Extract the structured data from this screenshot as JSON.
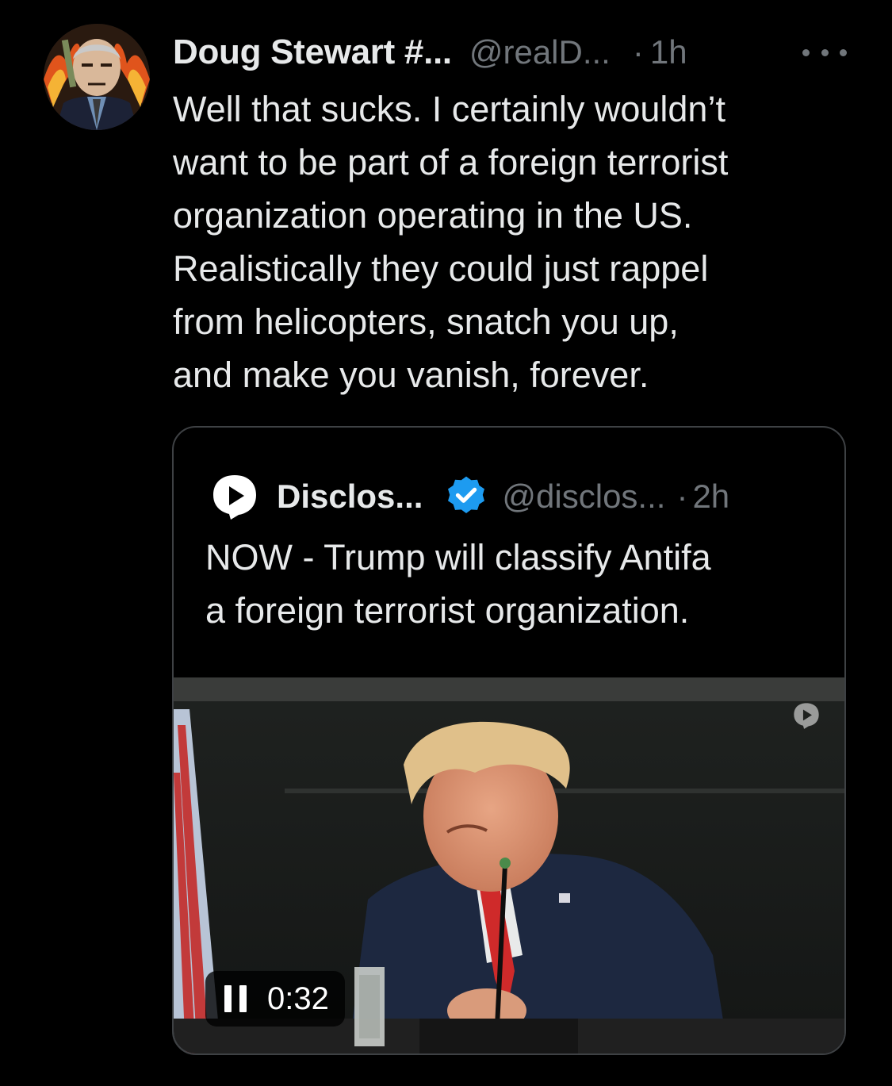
{
  "post": {
    "author": {
      "display_name": "Doug Stewart #...",
      "handle": "@realD...",
      "separator": "·",
      "time": "1h"
    },
    "text_lines": [
      "Well that sucks. I certainly wouldn’t",
      "want to be part of a foreign terrorist",
      "organization operating in the US.",
      "Realistically they could just rappel",
      "from helicopters, snatch you up,",
      "and make you vanish, forever."
    ],
    "more_icon": "more-horizontal-icon"
  },
  "quote": {
    "logo_icon": "disclose-tv-logo-icon",
    "display_name": "Disclos...",
    "verified_icon": "verified-badge-icon",
    "handle": "@disclos...",
    "separator": "·",
    "time": "2h",
    "text_lines": [
      "NOW - Trump will classify Antifa",
      "a foreign terrorist organization."
    ],
    "video": {
      "state_icon": "pause-icon",
      "elapsed": "0:32"
    }
  },
  "colors": {
    "background": "#000000",
    "primary_text": "#e7e9ea",
    "secondary_text": "#71767b",
    "border": "#3e4144",
    "verified_blue": "#1d9bf0"
  }
}
